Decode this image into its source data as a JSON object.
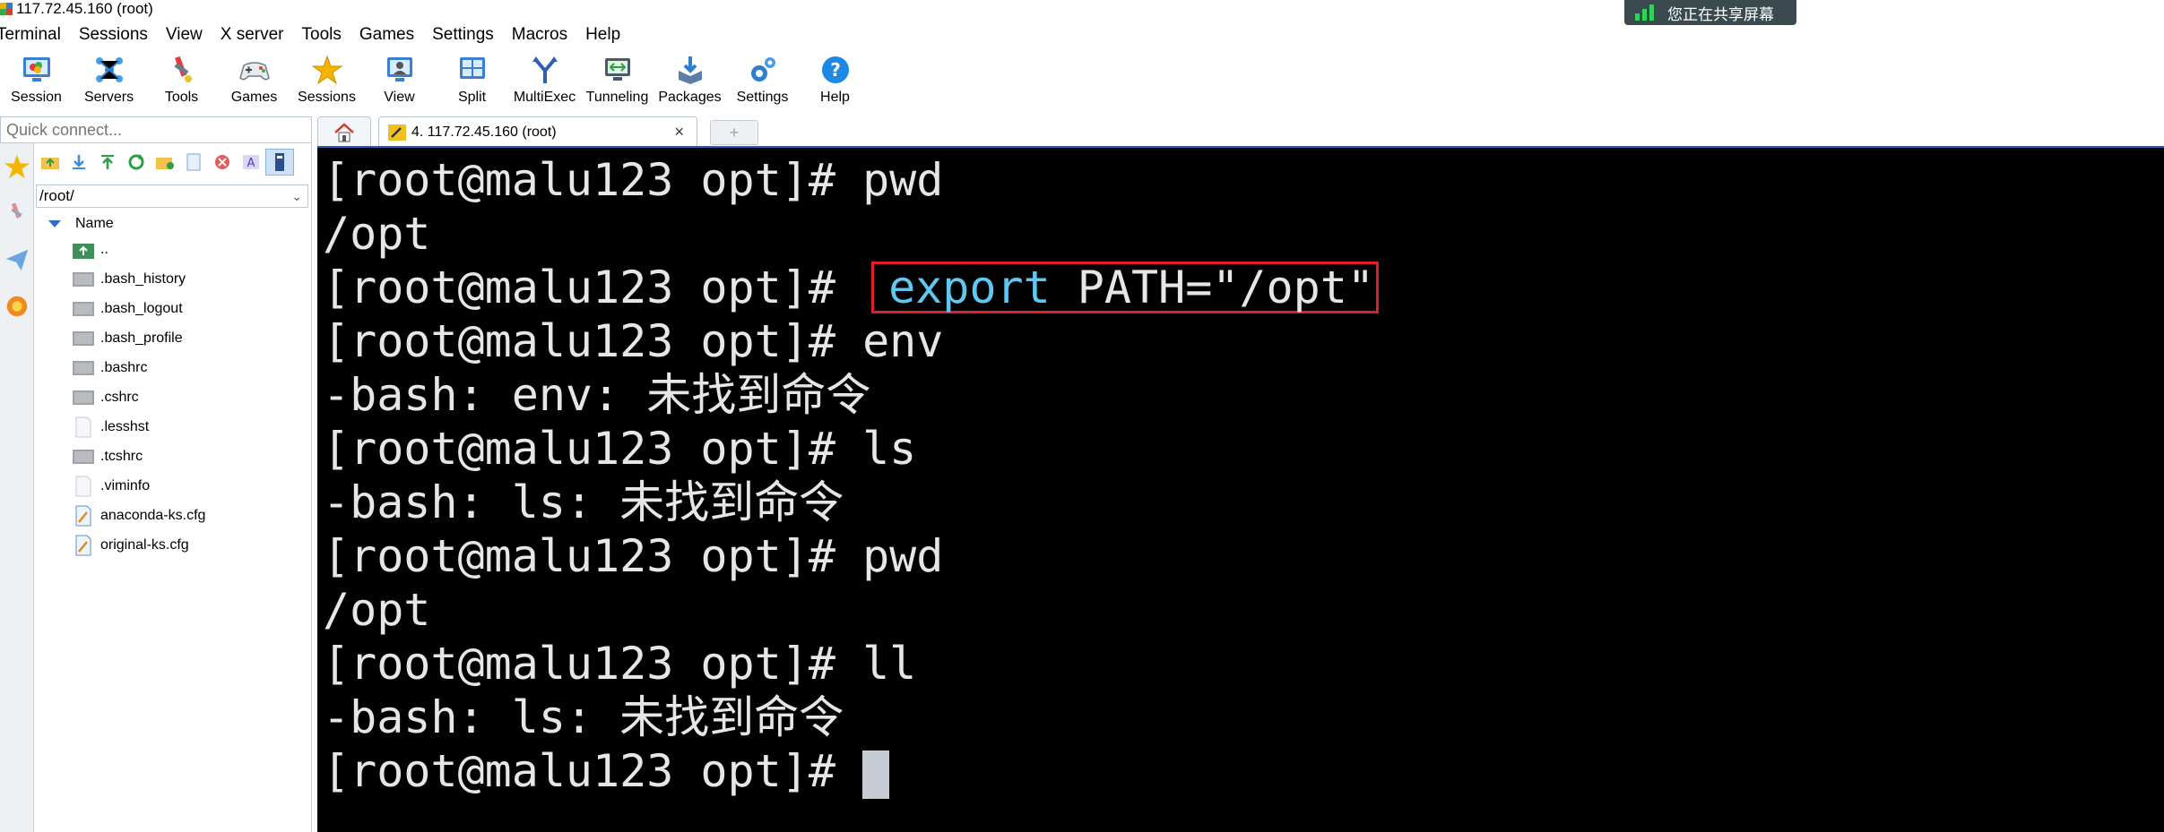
{
  "window": {
    "title": "117.72.45.160 (root)"
  },
  "share_badge": {
    "text": "您正在共享屏幕"
  },
  "menu": [
    "Terminal",
    "Sessions",
    "View",
    "X server",
    "Tools",
    "Games",
    "Settings",
    "Macros",
    "Help"
  ],
  "toolbar": [
    {
      "label": "Session",
      "icon": "session-icon"
    },
    {
      "label": "Servers",
      "icon": "servers-icon"
    },
    {
      "label": "Tools",
      "icon": "tools-icon"
    },
    {
      "label": "Games",
      "icon": "games-icon"
    },
    {
      "label": "Sessions",
      "icon": "star-icon"
    },
    {
      "label": "View",
      "icon": "view-icon"
    },
    {
      "label": "Split",
      "icon": "split-icon"
    },
    {
      "label": "MultiExec",
      "icon": "multiexec-icon"
    },
    {
      "label": "Tunneling",
      "icon": "tunneling-icon"
    },
    {
      "label": "Packages",
      "icon": "packages-icon"
    },
    {
      "label": "Settings",
      "icon": "gear-icon"
    },
    {
      "label": "Help",
      "icon": "help-icon"
    }
  ],
  "quick_connect": {
    "placeholder": "Quick connect..."
  },
  "browser": {
    "path": "/root/",
    "column_name": "Name",
    "files": [
      "..",
      ".bash_history",
      ".bash_logout",
      ".bash_profile",
      ".bashrc",
      ".cshrc",
      ".lesshst",
      ".tcshrc",
      ".viminfo",
      "anaconda-ks.cfg",
      "original-ks.cfg"
    ]
  },
  "tabs": {
    "active_label": "4. 117.72.45.160 (root)",
    "close": "×",
    "new": "+"
  },
  "terminal": {
    "prompt": "[root@malu123 opt]# ",
    "lines": [
      {
        "prompt": "[root@malu123 opt]# ",
        "text": "pwd"
      },
      {
        "prompt": "",
        "text": "/opt"
      },
      {
        "prompt": "[root@malu123 opt]# ",
        "keyword": "export",
        "text": " PATH=\"/opt\""
      },
      {
        "prompt": "[root@malu123 opt]# ",
        "text": "env"
      },
      {
        "prompt": "",
        "text": "-bash: env: 未找到命令"
      },
      {
        "prompt": "[root@malu123 opt]# ",
        "text": "ls"
      },
      {
        "prompt": "",
        "text": "-bash: ls: 未找到命令"
      },
      {
        "prompt": "[root@malu123 opt]# ",
        "text": "pwd"
      },
      {
        "prompt": "",
        "text": "/opt"
      },
      {
        "prompt": "[root@malu123 opt]# ",
        "text": "ll"
      },
      {
        "prompt": "",
        "text": "-bash: ls: 未找到命令"
      },
      {
        "prompt": "[root@malu123 opt]# ",
        "text": ""
      }
    ]
  },
  "colors": {
    "terminal_bg": "#000000",
    "keyword": "#5ec8f0",
    "highlight_box": "#e01e25",
    "accent": "#2a5fb0"
  }
}
